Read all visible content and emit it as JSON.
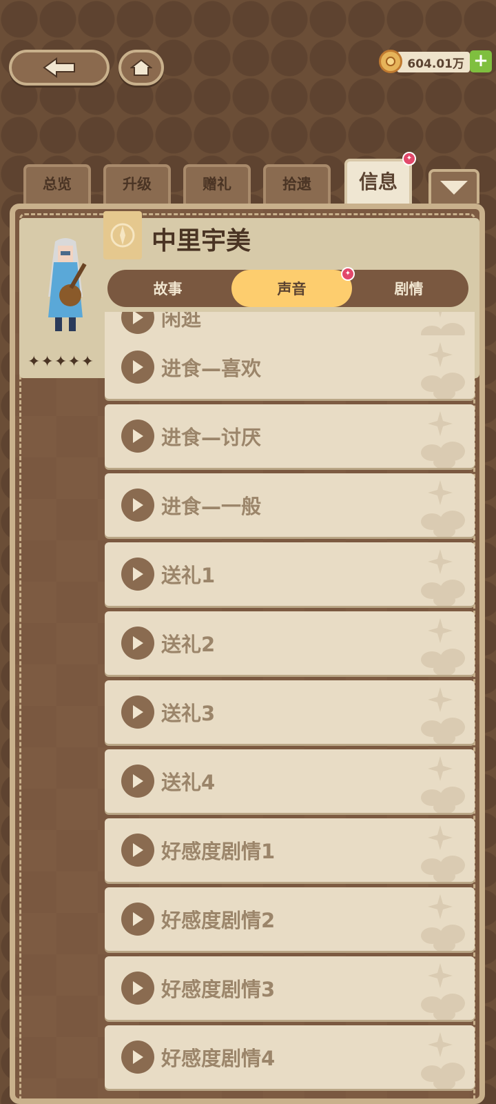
{
  "header": {
    "currency_value": "604.01万",
    "add_label": "+"
  },
  "tabs": [
    {
      "label": "总览"
    },
    {
      "label": "升级"
    },
    {
      "label": "赠礼"
    },
    {
      "label": "拾遗"
    },
    {
      "label": "信息",
      "active": true
    }
  ],
  "character": {
    "name": "中里宇美",
    "stars": "✦✦✦✦✦"
  },
  "subtabs": [
    {
      "label": "故事"
    },
    {
      "label": "声音",
      "active": true
    },
    {
      "label": "剧情"
    }
  ],
  "voice_items": [
    {
      "label": "闲逛"
    },
    {
      "label": "进食—喜欢"
    },
    {
      "label": "进食—讨厌"
    },
    {
      "label": "进食—一般"
    },
    {
      "label": "送礼1"
    },
    {
      "label": "送礼2"
    },
    {
      "label": "送礼3"
    },
    {
      "label": "送礼4"
    },
    {
      "label": "好感度剧情1"
    },
    {
      "label": "好感度剧情2"
    },
    {
      "label": "好感度剧情3"
    },
    {
      "label": "好感度剧情4"
    }
  ],
  "colors": {
    "accent": "#fdcd6e",
    "notification": "#e2486a",
    "panel": "#7a5840",
    "card": "#e8dcc5"
  }
}
